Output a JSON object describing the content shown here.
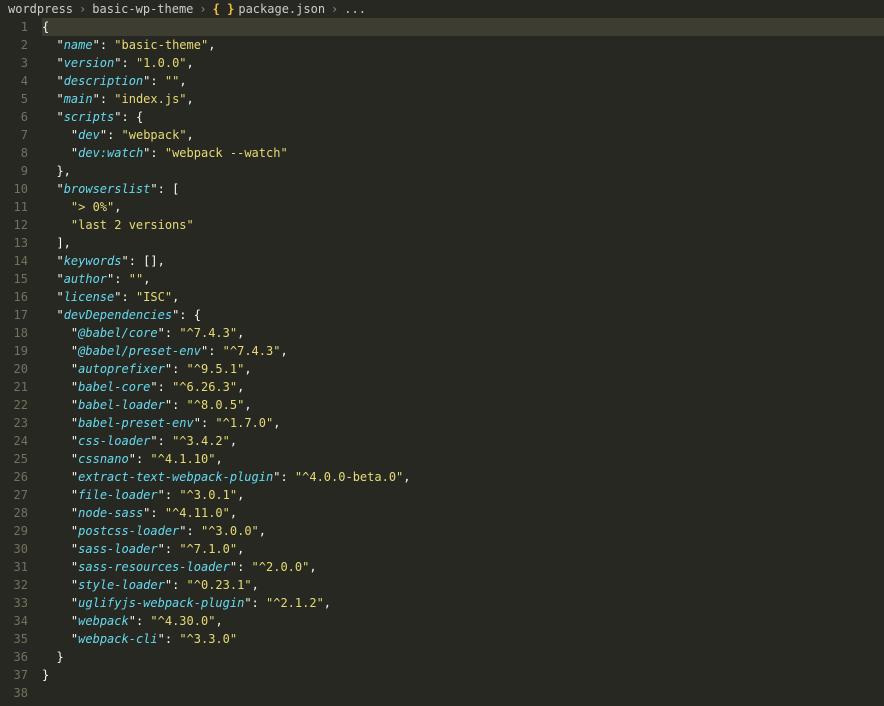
{
  "breadcrumb": {
    "seg1": "wordpress",
    "seg2": "basic-wp-theme",
    "file": "package.json",
    "tail": "..."
  },
  "json": {
    "name_key": "name",
    "name_val": "basic-theme",
    "version_key": "version",
    "version_val": "1.0.0",
    "description_key": "description",
    "description_val": "",
    "main_key": "main",
    "main_val": "index.js",
    "scripts_key": "scripts",
    "dev_key": "dev",
    "dev_val": "webpack",
    "devwatch_key": "dev:watch",
    "devwatch_val": "webpack --watch",
    "browserslist_key": "browserslist",
    "bl0": "> 0%",
    "bl1": "last 2 versions",
    "keywords_key": "keywords",
    "author_key": "author",
    "author_val": "",
    "license_key": "license",
    "license_val": "ISC",
    "devdeps_key": "devDependencies",
    "dd1_key": "@babel/core",
    "dd1_val": "^7.4.3",
    "dd2_key": "@babel/preset-env",
    "dd2_val": "^7.4.3",
    "dd3_key": "autoprefixer",
    "dd3_val": "^9.5.1",
    "dd4_key": "babel-core",
    "dd4_val": "^6.26.3",
    "dd5_key": "babel-loader",
    "dd5_val": "^8.0.5",
    "dd6_key": "babel-preset-env",
    "dd6_val": "^1.7.0",
    "dd7_key": "css-loader",
    "dd7_val": "^3.4.2",
    "dd8_key": "cssnano",
    "dd8_val": "^4.1.10",
    "dd9_key": "extract-text-webpack-plugin",
    "dd9_val": "^4.0.0-beta.0",
    "dd10_key": "file-loader",
    "dd10_val": "^3.0.1",
    "dd11_key": "node-sass",
    "dd11_val": "^4.11.0",
    "dd12_key": "postcss-loader",
    "dd12_val": "^3.0.0",
    "dd13_key": "sass-loader",
    "dd13_val": "^7.1.0",
    "dd14_key": "sass-resources-loader",
    "dd14_val": "^2.0.0",
    "dd15_key": "style-loader",
    "dd15_val": "^0.23.1",
    "dd16_key": "uglifyjs-webpack-plugin",
    "dd16_val": "^2.1.2",
    "dd17_key": "webpack",
    "dd17_val": "^4.30.0",
    "dd18_key": "webpack-cli",
    "dd18_val": "^3.3.0"
  }
}
